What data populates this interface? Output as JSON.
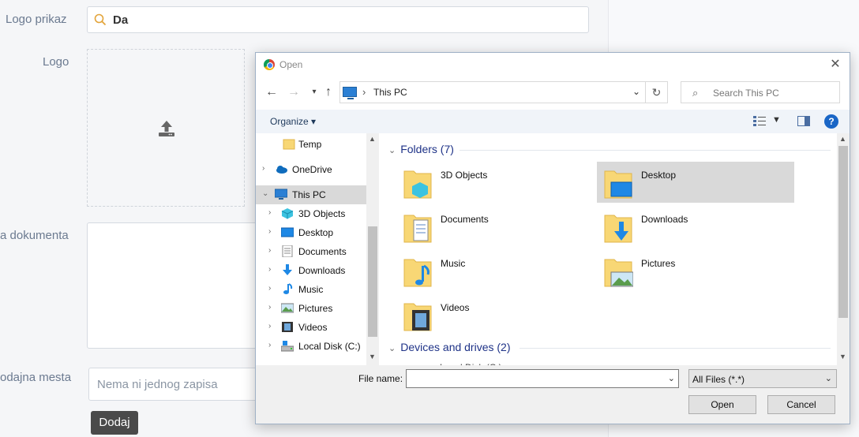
{
  "form": {
    "logo_prikaz_label": "Logo prikaz",
    "logo_prikaz_value": "Da",
    "logo_label": "Logo",
    "dokumenta_label": "a dokumenta",
    "mesta_label": "odajna mesta",
    "mesta_placeholder": "Nema ni jednog zapisa",
    "dodaj_button": "Dodaj"
  },
  "dialog": {
    "title": "Open",
    "close_glyph": "✕",
    "address": {
      "path": "This PC",
      "separator": "›"
    },
    "search_placeholder": "Search This PC",
    "organize_label": "Organize ▾",
    "help_glyph": "?",
    "nav_items": [
      {
        "label": "Temp",
        "icon": "folder-icon",
        "indent": 1,
        "expandable": false,
        "selected": false
      },
      {
        "label": "OneDrive",
        "icon": "onedrive-icon",
        "indent": 0,
        "expandable": true,
        "selected": false
      },
      {
        "label": "This PC",
        "icon": "pc-icon",
        "indent": 0,
        "expandable": true,
        "expanded": true,
        "selected": true
      },
      {
        "label": "3D Objects",
        "icon": "3d-objects-icon",
        "indent": 1,
        "expandable": true,
        "selected": false
      },
      {
        "label": "Desktop",
        "icon": "desktop-icon",
        "indent": 1,
        "expandable": true,
        "selected": false
      },
      {
        "label": "Documents",
        "icon": "documents-icon",
        "indent": 1,
        "expandable": true,
        "selected": false
      },
      {
        "label": "Downloads",
        "icon": "downloads-icon",
        "indent": 1,
        "expandable": true,
        "selected": false
      },
      {
        "label": "Music",
        "icon": "music-icon",
        "indent": 1,
        "expandable": true,
        "selected": false
      },
      {
        "label": "Pictures",
        "icon": "pictures-icon",
        "indent": 1,
        "expandable": true,
        "selected": false
      },
      {
        "label": "Videos",
        "icon": "videos-icon",
        "indent": 1,
        "expandable": true,
        "selected": false
      },
      {
        "label": "Local Disk (C:)",
        "icon": "disk-icon",
        "indent": 1,
        "expandable": true,
        "selected": false
      }
    ],
    "folders_header": "Folders (7)",
    "folders": [
      {
        "label": "3D Objects",
        "icon": "3d-objects-icon",
        "selected": false
      },
      {
        "label": "Desktop",
        "icon": "desktop-icon",
        "selected": true
      },
      {
        "label": "Documents",
        "icon": "documents-icon",
        "selected": false
      },
      {
        "label": "Downloads",
        "icon": "downloads-icon",
        "selected": false
      },
      {
        "label": "Music",
        "icon": "music-icon",
        "selected": false
      },
      {
        "label": "Pictures",
        "icon": "pictures-icon",
        "selected": false
      },
      {
        "label": "Videos",
        "icon": "videos-icon",
        "selected": false
      }
    ],
    "devices_header": "Devices and drives (2)",
    "partial_item": "Local Disk (C:)",
    "file_name_label": "File name:",
    "file_name_value": "",
    "file_type_value": "All Files (*.*)",
    "open_button": "Open",
    "cancel_button": "Cancel"
  },
  "colors": {
    "accent": "#1a66c6",
    "selected_bg": "#d9d9d9",
    "group_header": "#1e3287",
    "folder_yellow": "#f8d775"
  }
}
